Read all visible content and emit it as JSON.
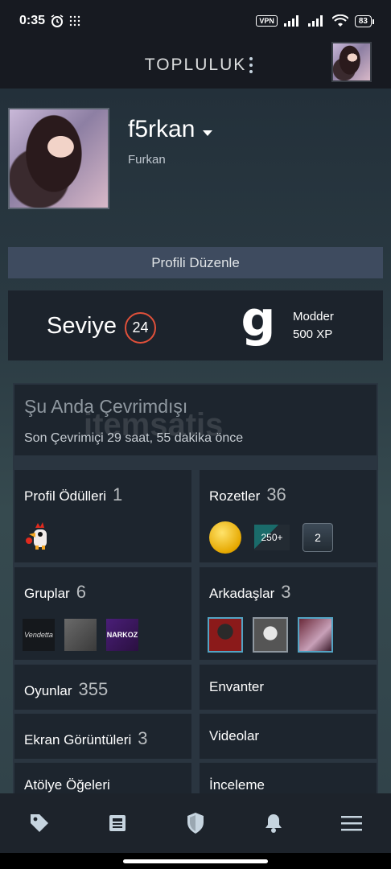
{
  "status_bar": {
    "time": "0:35",
    "vpn": "VPN",
    "battery": "83"
  },
  "header": {
    "title": "TOPLULUK"
  },
  "profile": {
    "username": "f5rkan",
    "real_name": "Furkan",
    "edit_button": "Profili Düzenle"
  },
  "level": {
    "label": "Seviye",
    "value": "24",
    "badge_letter": "g",
    "badge_name": "Modder",
    "badge_xp": "500 XP"
  },
  "status": {
    "title": "Şu Anda Çevrimdışı",
    "last_online": "Son Çevrimiçi 29 saat, 55 dakika önce"
  },
  "watermark": "itemsatis",
  "tiles": {
    "awards": {
      "label": "Profil Ödülleri",
      "count": "1"
    },
    "badges": {
      "label": "Rozetler",
      "count": "36",
      "items": [
        "250+",
        "2"
      ]
    },
    "groups": {
      "label": "Gruplar",
      "count": "6",
      "items": [
        "Vendetta",
        "",
        "NARKOZ"
      ]
    },
    "friends": {
      "label": "Arkadaşlar",
      "count": "3"
    },
    "games": {
      "label": "Oyunlar",
      "count": "355"
    },
    "inventory": {
      "label": "Envanter"
    },
    "screenshots": {
      "label": "Ekran Görüntüleri",
      "count": "3"
    },
    "videos": {
      "label": "Videolar"
    },
    "workshop": {
      "label": "Atölye Öğeleri"
    },
    "reviews": {
      "label": "İnceleme"
    }
  },
  "nav": {
    "items": [
      "tag-icon",
      "news-icon",
      "shield-icon",
      "bell-icon",
      "menu-icon"
    ]
  },
  "colors": {
    "accent_level": "#e0503a",
    "background": "#1b2129",
    "panel": "#1d252e"
  }
}
